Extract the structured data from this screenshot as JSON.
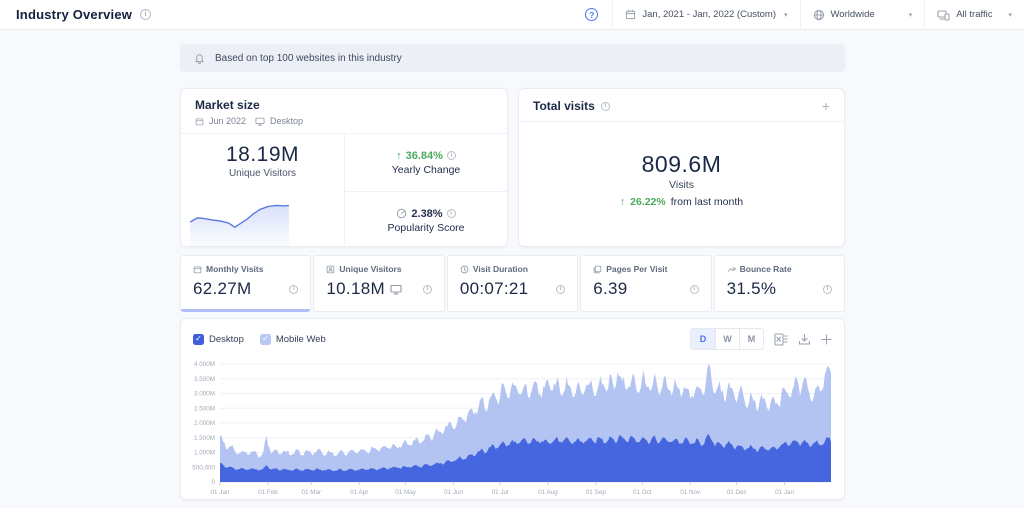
{
  "topbar": {
    "title": "Industry Overview",
    "help": "?",
    "date_range": "Jan, 2021 - Jan, 2022 (Custom)",
    "geo": "Worldwide",
    "traffic": "All traffic",
    "caret": "▾"
  },
  "notice": {
    "text": "Based on top 100 websites in this industry"
  },
  "market_size": {
    "title": "Market size",
    "date": "Jun 2022",
    "device": "Desktop",
    "value": "18.19M",
    "value_label": "Unique Visitors",
    "yearly_change": {
      "arrow": "↑",
      "value": "36.84%",
      "label": "Yearly Change"
    },
    "popularity": {
      "value": "2.38%",
      "label": "Popularity Score"
    },
    "sparkline": {
      "line_color": "#5b7be0",
      "fill_color": "#ccd8f8",
      "points": [
        [
          3,
          26
        ],
        [
          10,
          22
        ],
        [
          16,
          22.5
        ],
        [
          24,
          24
        ],
        [
          32,
          25
        ],
        [
          40,
          27
        ],
        [
          46,
          31
        ],
        [
          52,
          27
        ],
        [
          58,
          23
        ],
        [
          64,
          18
        ],
        [
          70,
          14
        ],
        [
          78,
          11
        ],
        [
          86,
          10
        ],
        [
          93,
          10.5
        ],
        [
          98,
          10
        ]
      ]
    }
  },
  "total_visits": {
    "title": "Total visits",
    "add_label": "+",
    "value": "809.6M",
    "value_label": "Visits",
    "change_arrow": "↑",
    "change": "26.22%",
    "change_suffix": "from last month"
  },
  "metrics": [
    {
      "label": "Monthly Visits",
      "value": "62.27M",
      "selected": true
    },
    {
      "label": "Unique Visitors",
      "value": "10.18M",
      "selected": false
    },
    {
      "label": "Visit Duration",
      "value": "00:07:21",
      "selected": false
    },
    {
      "label": "Pages Per Visit",
      "value": "6.39",
      "selected": false
    },
    {
      "label": "Bounce Rate",
      "value": "31.5%",
      "selected": false
    }
  ],
  "chart": {
    "legend": [
      {
        "label": "Desktop",
        "checkbox_color": "#3f5ed9",
        "check": "✓"
      },
      {
        "label": "Mobile Web",
        "checkbox_color": "#b9c8f5",
        "check": "✓"
      }
    ],
    "granularities": [
      "D",
      "W",
      "M"
    ],
    "selected_granularity": "D",
    "accent_color": "#4a72f6"
  },
  "chart_data": {
    "type": "area",
    "stacked": true,
    "x_range_days": 396,
    "x_ticks": [
      {
        "day": 0,
        "label": "01 Jan"
      },
      {
        "day": 31,
        "label": "01 Feb"
      },
      {
        "day": 59,
        "label": "01 Mar"
      },
      {
        "day": 90,
        "label": "01 Apr"
      },
      {
        "day": 120,
        "label": "01 May"
      },
      {
        "day": 151,
        "label": "01 Jun"
      },
      {
        "day": 181,
        "label": "01 Jul"
      },
      {
        "day": 212,
        "label": "01 Aug"
      },
      {
        "day": 243,
        "label": "01 Sep"
      },
      {
        "day": 273,
        "label": "01 Oct"
      },
      {
        "day": 304,
        "label": "01 Nov"
      },
      {
        "day": 334,
        "label": "01 Dec"
      },
      {
        "day": 365,
        "label": "01 Jan"
      }
    ],
    "y_axis": {
      "max_millions": 4,
      "step_millions": 0.5,
      "labels_top_to_bottom": [
        "4.000M",
        "3.500M",
        "3.000M",
        "2.500M",
        "2.000M",
        "1.500M",
        "1.000M",
        "500,000",
        "0"
      ]
    },
    "series": [
      {
        "name": "Desktop",
        "color": "#4566df"
      },
      {
        "name": "Mobile Web",
        "color": "#b3c4f2"
      }
    ],
    "desktop_keyframes_day_millions": [
      [
        0,
        0.62
      ],
      [
        4,
        0.52
      ],
      [
        10,
        0.45
      ],
      [
        20,
        0.43
      ],
      [
        28,
        0.42
      ],
      [
        30,
        0.58
      ],
      [
        33,
        0.44
      ],
      [
        45,
        0.41
      ],
      [
        60,
        0.42
      ],
      [
        75,
        0.4
      ],
      [
        90,
        0.42
      ],
      [
        100,
        0.44
      ],
      [
        110,
        0.47
      ],
      [
        120,
        0.5
      ],
      [
        130,
        0.55
      ],
      [
        140,
        0.62
      ],
      [
        150,
        0.72
      ],
      [
        160,
        0.86
      ],
      [
        170,
        1.05
      ],
      [
        180,
        1.25
      ],
      [
        190,
        1.33
      ],
      [
        200,
        1.38
      ],
      [
        215,
        1.4
      ],
      [
        230,
        1.38
      ],
      [
        245,
        1.42
      ],
      [
        257,
        1.48
      ],
      [
        270,
        1.45
      ],
      [
        285,
        1.42
      ],
      [
        300,
        1.38
      ],
      [
        310,
        1.32
      ],
      [
        317,
        1.5
      ],
      [
        320,
        1.3
      ],
      [
        330,
        1.25
      ],
      [
        340,
        1.16
      ],
      [
        350,
        1.12
      ],
      [
        358,
        1.14
      ],
      [
        365,
        1.28
      ],
      [
        375,
        1.33
      ],
      [
        385,
        1.28
      ],
      [
        392,
        1.4
      ],
      [
        395,
        1.45
      ]
    ],
    "total_keyframes_day_millions": [
      [
        0,
        1.52
      ],
      [
        4,
        1.28
      ],
      [
        10,
        1.05
      ],
      [
        20,
        0.97
      ],
      [
        28,
        0.95
      ],
      [
        30,
        1.5
      ],
      [
        33,
        1.04
      ],
      [
        45,
        0.98
      ],
      [
        60,
        1.02
      ],
      [
        75,
        0.97
      ],
      [
        90,
        1.03
      ],
      [
        100,
        1.1
      ],
      [
        110,
        1.18
      ],
      [
        120,
        1.28
      ],
      [
        130,
        1.45
      ],
      [
        140,
        1.65
      ],
      [
        150,
        1.95
      ],
      [
        160,
        2.3
      ],
      [
        170,
        2.65
      ],
      [
        180,
        2.95
      ],
      [
        190,
        3.15
      ],
      [
        200,
        3.05
      ],
      [
        215,
        3.25
      ],
      [
        230,
        3.15
      ],
      [
        245,
        3.3
      ],
      [
        255,
        3.4
      ],
      [
        257,
        3.8
      ],
      [
        260,
        3.3
      ],
      [
        275,
        3.35
      ],
      [
        290,
        3.2
      ],
      [
        300,
        3.1
      ],
      [
        310,
        3.0
      ],
      [
        317,
        3.85
      ],
      [
        320,
        3.05
      ],
      [
        330,
        3.1
      ],
      [
        340,
        2.85
      ],
      [
        350,
        2.7
      ],
      [
        358,
        2.62
      ],
      [
        365,
        3.0
      ],
      [
        375,
        3.3
      ],
      [
        385,
        3.05
      ],
      [
        392,
        3.55
      ],
      [
        395,
        3.75
      ]
    ],
    "daily_variation": {
      "weekly_amplitude": 0.08,
      "noise_amplitude": 0.055
    }
  }
}
